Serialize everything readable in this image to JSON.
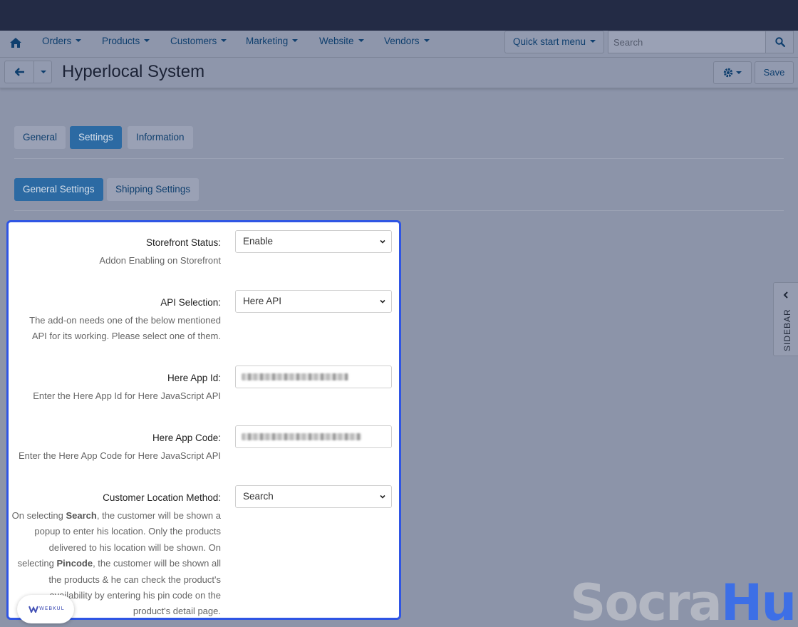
{
  "nav": {
    "items": [
      {
        "label": "Orders"
      },
      {
        "label": "Products"
      },
      {
        "label": "Customers"
      },
      {
        "label": "Marketing"
      },
      {
        "label": "Website"
      },
      {
        "label": "Vendors"
      }
    ],
    "quick_start_label": "Quick start menu",
    "search_placeholder": "Search"
  },
  "header": {
    "title": "Hyperlocal System",
    "save_label": "Save"
  },
  "tabs": [
    {
      "label": "General",
      "active": false
    },
    {
      "label": "Settings",
      "active": true
    },
    {
      "label": "Information",
      "active": false
    }
  ],
  "subtabs": [
    {
      "label": "General Settings",
      "active": true
    },
    {
      "label": "Shipping Settings",
      "active": false
    }
  ],
  "settings": {
    "storefront_status": {
      "label": "Storefront Status:",
      "value": "Enable",
      "help": "Addon Enabling on Storefront"
    },
    "api_selection": {
      "label": "API Selection:",
      "value": "Here API",
      "help": "The add-on needs one of the below mentioned API for its working. Please select one of them."
    },
    "here_app_id": {
      "label": "Here App Id:",
      "help": "Enter the Here App Id for Here JavaScript API"
    },
    "here_app_code": {
      "label": "Here App Code:",
      "help": "Enter the Here App Code for Here JavaScript API"
    },
    "customer_location_method": {
      "label": "Customer Location Method:",
      "value": "Search",
      "help_1": "On selecting ",
      "help_bold_1": "Search",
      "help_2": ", the customer will be shown a popup to enter his location. Only the products delivered to his location will be shown. On selecting ",
      "help_bold_2": "Pincode",
      "help_3": ", the customer will be shown all the products & he can check the product's availability by entering his pin code on the product's detail page."
    }
  },
  "sidebar_label": "SIDEBAR",
  "watermark": {
    "part1": "Socra",
    "part2": "Hub"
  },
  "webkul_label": "WEBKUL",
  "colors": {
    "accent": "#2c6aa3",
    "panel_border": "#2f55e4",
    "topbar": "#232b45"
  }
}
